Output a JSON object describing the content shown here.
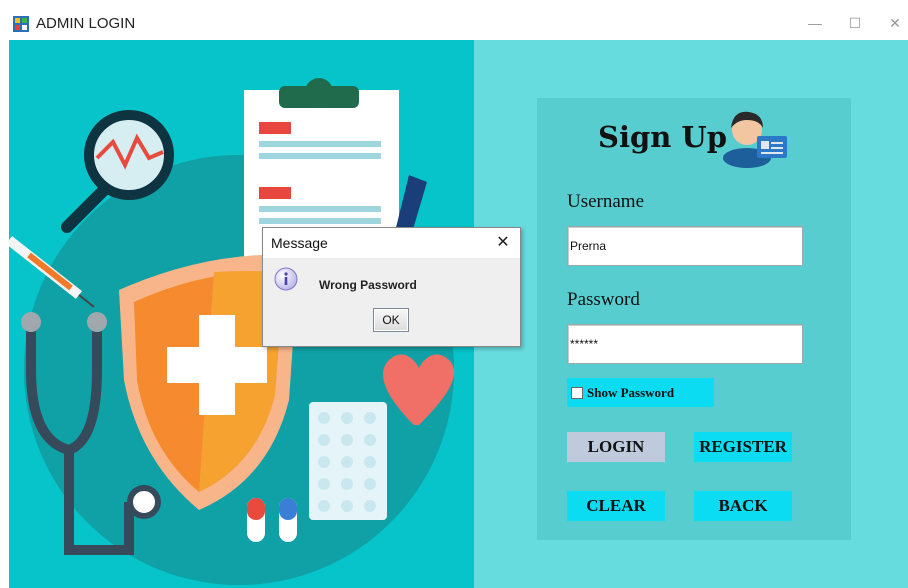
{
  "window": {
    "title": "ADMIN LOGIN",
    "minimize_glyph": "—",
    "maximize_glyph": "☐",
    "close_glyph": "✕"
  },
  "signup": {
    "title": "Sign Up",
    "username_label": "Username",
    "username_value": "Prerna",
    "password_label": "Password",
    "password_value": "******",
    "show_password_label": "Show Password",
    "show_password_checked": false
  },
  "buttons": {
    "login": "LOGIN",
    "register": "REGISTER",
    "clear": "CLEAR",
    "back": "BACK"
  },
  "dialog": {
    "title": "Message",
    "message": "Wrong Password",
    "ok": "OK",
    "close_glyph": "✕",
    "icon": "info-icon"
  },
  "colors": {
    "background": "#67dcdf",
    "panel": "#58cdd0",
    "button_accent": "#0bdcf2",
    "login_button": "#bfcbdc",
    "illustration_base": "#06b8c0"
  },
  "icons": [
    "app-icon",
    "user-card-icon",
    "info-icon",
    "medical-illustration"
  ]
}
